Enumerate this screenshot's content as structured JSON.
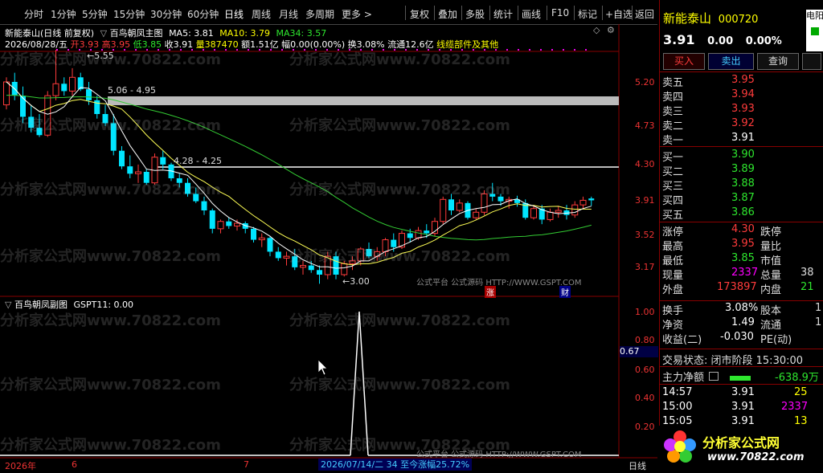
{
  "toolbar": {
    "periods": [
      "分时",
      "1分钟",
      "5分钟",
      "15分钟",
      "30分钟",
      "60分钟",
      "日线",
      "周线",
      "月线",
      "多周期",
      "更多 >"
    ],
    "active_period": "日线",
    "tools": [
      "复权",
      "叠加",
      "多股",
      "统计",
      "画线",
      "F10",
      "标记",
      "+自选",
      "返回"
    ]
  },
  "stock": {
    "name": "新能泰山",
    "code": "000720",
    "price": "3.91",
    "change": "0.00",
    "change_pct": "0.00%",
    "trade_buy": "买入",
    "trade_sell": "卖出",
    "query": "查询",
    "side_tab": "电阳"
  },
  "main": {
    "title": "新能泰山(日线 前复权)",
    "indicator_name": "百鸟朝凤主图",
    "ma5": "MA5: 3.81",
    "ma10": "MA10: 3.79",
    "ma34": "MA34: 3.57",
    "date": "2026/08/28/五",
    "open": "开3.93",
    "high": "高3.95",
    "low": "低3.85",
    "close": "收3.91",
    "volume": "量387470",
    "amount": "额1.51亿",
    "amp": "幅0.00(0.00%)",
    "turnover": "换3.08%",
    "float": "流通12.6亿",
    "sector": "线缆部件及其他",
    "annot_high": "5.55",
    "annot_range1": "5.06 - 4.95",
    "annot_range2": "4.28 - 4.25",
    "annot_low": "3.00",
    "platform_text": "公式平台 公式源码 HTTP://WWW.GSPT.COM",
    "tag_zhang": "涨",
    "tag_cai": "财",
    "yticks": [
      "5.20",
      "4.73",
      "4.30",
      "3.91",
      "3.52",
      "3.17"
    ]
  },
  "sub": {
    "title": "百鸟朝凤副图",
    "gspt": "GSPT11: 0.00",
    "yticks": [
      "1.00",
      "0.80",
      "0.60",
      "0.40",
      "0.20"
    ],
    "cursor_value": "0.67",
    "platform_text": "公式平台 公式源码 HTTP://WWW.GSPT.COM"
  },
  "xaxis": {
    "year": "2026年",
    "m6": "6",
    "m7": "7",
    "range_info": "2026/07/14/二 34 至今涨幅25.72%",
    "period_label": "日线"
  },
  "watermark": "分析家公式网www.70822.com",
  "quotes": {
    "sell": [
      {
        "label": "卖五",
        "price": "3.95"
      },
      {
        "label": "卖四",
        "price": "3.94"
      },
      {
        "label": "卖三",
        "price": "3.93"
      },
      {
        "label": "卖二",
        "price": "3.92"
      },
      {
        "label": "卖一",
        "price": "3.91"
      }
    ],
    "buy": [
      {
        "label": "买一",
        "price": "3.90"
      },
      {
        "label": "买二",
        "price": "3.89"
      },
      {
        "label": "买三",
        "price": "3.88"
      },
      {
        "label": "买四",
        "price": "3.87"
      },
      {
        "label": "买五",
        "price": "3.86"
      }
    ]
  },
  "stats": {
    "zhangting_l": "涨停",
    "zhangting_v": "4.30",
    "dieting_l": "跌停",
    "zuigao_l": "最高",
    "zuigao_v": "3.95",
    "liangbi_l": "量比",
    "zuidi_l": "最低",
    "zuidi_v": "3.85",
    "shizhi_l": "市值",
    "xianliang_l": "现量",
    "xianliang_v": "2337",
    "zongliang_l": "总量",
    "zongliang_v": "38",
    "waipan_l": "外盘",
    "waipan_v": "173897",
    "neipan_l": "内盘",
    "neipan_v": "21",
    "huanshou_l": "换手",
    "huanshou_v": "3.08%",
    "guben_l": "股本",
    "guben_v": "1",
    "jingzi_l": "净资",
    "jingzi_v": "1.49",
    "liutong_l": "流通",
    "liutong_v": "1",
    "shouyi_l": "收益(二)",
    "shouyi_v": "-0.030",
    "pe_l": "PE(动)"
  },
  "status": {
    "trade_state": "交易状态: 闭市阶段 15:30:00",
    "main_flow_label": "主力净额",
    "main_flow_value": "-638.9万"
  },
  "ticks": [
    {
      "time": "14:57",
      "price": "3.91",
      "vol": "25"
    },
    {
      "time": "15:00",
      "price": "3.91",
      "vol": "2337"
    },
    {
      "time": "15:05",
      "price": "3.91",
      "vol": "13"
    }
  ],
  "logo": {
    "text": "分析家公式网",
    "url": "www.70822.com"
  },
  "colors": {
    "up": "#ff3b3b",
    "down": "#00e5ff",
    "ma5": "#ffffff",
    "ma10": "#ffff00",
    "ma34": "#33cc33"
  },
  "chart_data": {
    "type": "candlestick",
    "ma5": "3.81",
    "ma10": "3.79",
    "ma34": "3.57",
    "candles": [
      [
        4.95,
        5.25,
        4.9,
        5.2,
        1
      ],
      [
        5.2,
        5.3,
        5.0,
        5.05,
        0
      ],
      [
        5.05,
        5.15,
        4.75,
        4.82,
        0
      ],
      [
        4.82,
        4.95,
        4.65,
        4.7,
        0
      ],
      [
        4.7,
        4.85,
        4.6,
        4.62,
        0
      ],
      [
        4.62,
        5.1,
        4.6,
        5.05,
        1
      ],
      [
        5.05,
        5.55,
        5.0,
        5.18,
        1
      ],
      [
        5.18,
        5.25,
        5.05,
        5.1,
        0
      ],
      [
        5.1,
        5.35,
        5.05,
        5.25,
        1
      ],
      [
        5.25,
        5.3,
        5.1,
        5.12,
        0
      ],
      [
        5.12,
        5.2,
        4.95,
        5.0,
        0
      ],
      [
        5.0,
        5.05,
        4.8,
        4.85,
        0
      ],
      [
        4.85,
        4.95,
        4.72,
        4.75,
        0
      ],
      [
        4.75,
        4.85,
        4.4,
        4.45,
        0
      ],
      [
        4.45,
        4.5,
        4.25,
        4.28,
        0
      ],
      [
        4.28,
        4.4,
        4.15,
        4.2,
        0
      ],
      [
        4.2,
        4.3,
        4.1,
        4.22,
        1
      ],
      [
        4.22,
        4.25,
        4.08,
        4.1,
        0
      ],
      [
        4.1,
        4.42,
        4.08,
        4.38,
        1
      ],
      [
        4.38,
        4.45,
        4.25,
        4.3,
        0
      ],
      [
        4.3,
        4.32,
        4.12,
        4.15,
        0
      ],
      [
        4.15,
        4.2,
        4.05,
        4.1,
        0
      ],
      [
        4.1,
        4.15,
        3.95,
        3.98,
        0
      ],
      [
        3.98,
        4.05,
        3.88,
        3.9,
        0
      ],
      [
        3.9,
        3.95,
        3.75,
        3.8,
        0
      ],
      [
        3.8,
        3.82,
        3.55,
        3.6,
        0
      ],
      [
        3.6,
        3.7,
        3.55,
        3.68,
        1
      ],
      [
        3.68,
        3.72,
        3.6,
        3.63,
        0
      ],
      [
        3.63,
        3.7,
        3.58,
        3.66,
        1
      ],
      [
        3.66,
        3.68,
        3.55,
        3.6,
        0
      ],
      [
        3.6,
        3.62,
        3.45,
        3.48,
        0
      ],
      [
        3.48,
        3.55,
        3.4,
        3.5,
        1
      ],
      [
        3.5,
        3.52,
        3.3,
        3.35,
        0
      ],
      [
        3.35,
        3.4,
        3.25,
        3.28,
        0
      ],
      [
        3.28,
        3.35,
        3.2,
        3.3,
        1
      ],
      [
        3.3,
        3.38,
        3.15,
        3.18,
        0
      ],
      [
        3.18,
        3.25,
        3.1,
        3.2,
        1
      ],
      [
        3.2,
        3.25,
        3.12,
        3.15,
        0
      ],
      [
        3.15,
        3.2,
        3.0,
        3.1,
        0
      ],
      [
        3.1,
        3.35,
        3.05,
        3.3,
        1
      ],
      [
        3.3,
        3.35,
        3.05,
        3.1,
        0
      ],
      [
        3.1,
        3.25,
        3.08,
        3.22,
        1
      ],
      [
        3.22,
        3.3,
        3.15,
        3.25,
        1
      ],
      [
        3.25,
        3.4,
        3.2,
        3.38,
        1
      ],
      [
        3.38,
        3.45,
        3.28,
        3.3,
        0
      ],
      [
        3.3,
        3.4,
        3.25,
        3.35,
        1
      ],
      [
        3.35,
        3.5,
        3.3,
        3.48,
        1
      ],
      [
        3.48,
        3.55,
        3.35,
        3.4,
        0
      ],
      [
        3.4,
        3.58,
        3.38,
        3.55,
        1
      ],
      [
        3.55,
        3.6,
        3.45,
        3.5,
        0
      ],
      [
        3.5,
        3.62,
        3.48,
        3.58,
        1
      ],
      [
        3.58,
        3.65,
        3.5,
        3.55,
        0
      ],
      [
        3.55,
        3.72,
        3.52,
        3.68,
        1
      ],
      [
        3.68,
        3.95,
        3.65,
        3.92,
        1
      ],
      [
        3.92,
        3.98,
        3.75,
        3.8,
        0
      ],
      [
        3.8,
        3.92,
        3.78,
        3.88,
        1
      ],
      [
        3.88,
        3.9,
        3.7,
        3.72,
        0
      ],
      [
        3.72,
        3.82,
        3.7,
        3.78,
        1
      ],
      [
        3.78,
        4.02,
        3.75,
        3.98,
        1
      ],
      [
        3.98,
        4.1,
        3.9,
        3.95,
        0
      ],
      [
        3.95,
        3.98,
        3.85,
        3.9,
        0
      ],
      [
        3.9,
        3.95,
        3.82,
        3.92,
        1
      ],
      [
        3.92,
        3.96,
        3.84,
        3.88,
        0
      ],
      [
        3.88,
        3.92,
        3.7,
        3.72,
        0
      ],
      [
        3.72,
        3.85,
        3.7,
        3.82,
        1
      ],
      [
        3.82,
        3.86,
        3.65,
        3.7,
        0
      ],
      [
        3.7,
        3.82,
        3.68,
        3.78,
        1
      ],
      [
        3.78,
        3.85,
        3.72,
        3.8,
        1
      ],
      [
        3.8,
        3.86,
        3.7,
        3.75,
        0
      ],
      [
        3.75,
        3.9,
        3.72,
        3.86,
        1
      ],
      [
        3.86,
        3.95,
        3.82,
        3.91,
        1
      ],
      [
        3.93,
        3.95,
        3.85,
        3.91,
        0
      ]
    ]
  }
}
